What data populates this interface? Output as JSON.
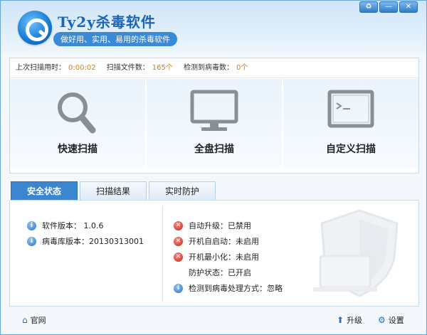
{
  "header": {
    "title": "Ty2y杀毒软件",
    "subtitle": "做好用、实用、易用的杀毒软件"
  },
  "window_controls": {
    "menu": "♻",
    "minimize": "—",
    "close": "✕"
  },
  "stats": {
    "last_scan_label": "上次扫描用时：",
    "last_scan_value": "0:00:02",
    "files_label": "扫描文件数：",
    "files_value": "165个",
    "virus_label": "检测到病毒数：",
    "virus_value": "0个"
  },
  "actions": [
    {
      "label": "快速扫描",
      "icon": "magnifier-icon"
    },
    {
      "label": "全盘扫描",
      "icon": "monitor-icon"
    },
    {
      "label": "自定义扫描",
      "icon": "terminal-icon"
    }
  ],
  "tabs": [
    {
      "label": "安全状态",
      "active": true
    },
    {
      "label": "扫描结果",
      "active": false
    },
    {
      "label": "实时防护",
      "active": false
    }
  ],
  "info": {
    "software_version": "软件版本： 1.0.6",
    "db_version": "病毒库版本：20130313001"
  },
  "status": [
    {
      "text": "自动升级：已禁用",
      "icon": "error-icon"
    },
    {
      "text": "开机自启动：未启用",
      "icon": "error-icon"
    },
    {
      "text": "开机最小化：未启用",
      "icon": "error-icon"
    },
    {
      "text": "防护状态：已开启",
      "icon": "none"
    },
    {
      "text": "检测到病毒处理方式：忽略",
      "icon": "info-icon"
    }
  ],
  "footer": {
    "website": "官网",
    "upgrade": "升级",
    "settings": "设置"
  },
  "colors": {
    "accent": "#3c86d0",
    "warning_value": "#e07b00",
    "error": "#c0221a"
  }
}
